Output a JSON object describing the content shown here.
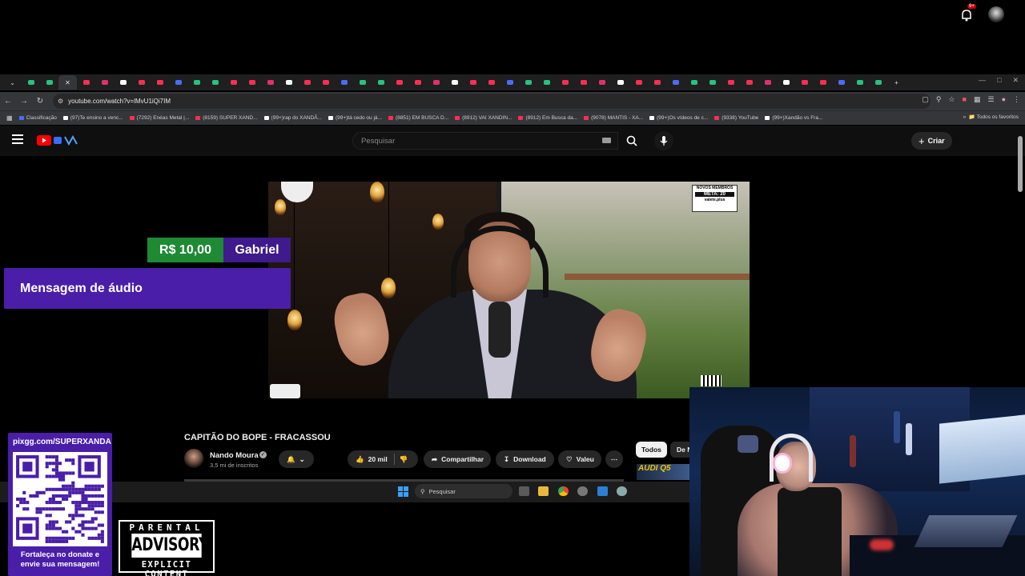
{
  "browser": {
    "tab_count": 48,
    "address": "youtube.com/watch?v=lMvU1iQi7IM",
    "bookmarks": [
      {
        "label": "Classificação",
        "color": "#4a6cf7"
      },
      {
        "label": "(97)Te ensino a venc...",
        "color": "#ffffff"
      },
      {
        "label": "(7292) Enéas Metal |...",
        "color": "#ff2d55"
      },
      {
        "label": "(8159) SUPER XAND...",
        "color": "#ff2d55"
      },
      {
        "label": "(99+)rap do XANDÃ...",
        "color": "#ffffff"
      },
      {
        "label": "(99+)tá cedo ou já...",
        "color": "#ffffff"
      },
      {
        "label": "(8851) EM BUSCA D...",
        "color": "#ff2d55"
      },
      {
        "label": "(8912) VAI XANDIN...",
        "color": "#ff2d55"
      },
      {
        "label": "(8912) Em Busca da...",
        "color": "#ff2d55"
      },
      {
        "label": "(9078) MANTIS - XA...",
        "color": "#ff2d55"
      },
      {
        "label": "(99+)Os vídeos de c...",
        "color": "#ffffff"
      },
      {
        "label": "(9338) YouTube",
        "color": "#ff2d55"
      },
      {
        "label": "(99+)Xandão vs Fra...",
        "color": "#ffffff"
      }
    ],
    "all_favorites": "Todos os favoritos"
  },
  "youtube": {
    "search_placeholder": "Pesquisar",
    "create_label": "Criar",
    "notif_badge": "9+",
    "video_title": "CAPITÃO DO BOPE - FRACASSOU",
    "channel_name": "Nando Moura",
    "channel_subs": "3,5 mi de inscritos",
    "likes": "20 mil",
    "share_label": "Compartilhar",
    "download_label": "Download",
    "thanks_label": "Valeu",
    "chip_all": "Todos",
    "chip_2": "De N",
    "thumb_text": "AUDI Q5",
    "video_overlay": {
      "meta_title": "NOVOS MEMBROS",
      "meta_value": "META: 20",
      "meta_site": "valete.plus"
    }
  },
  "donation": {
    "amount": "R$ 10,00",
    "name": "Gabriel",
    "message": "Mensagem de áudio"
  },
  "qr_card": {
    "url": "pixgg.com/SUPERXANDA",
    "caption_1": "Fortaleça no donate e",
    "caption_2": "envie sua mensagem!"
  },
  "advisory": {
    "top": "PARENTAL",
    "mid": "ADVISORY",
    "bot": "EXPLICIT CONTENT"
  },
  "taskbar": {
    "search_placeholder": "Pesquisar"
  },
  "colors": {
    "donation_green": "#1f8a34",
    "donation_purple": "#3e1a8c",
    "card_purple": "#4a1ea8",
    "yt_red": "#ff0000"
  }
}
